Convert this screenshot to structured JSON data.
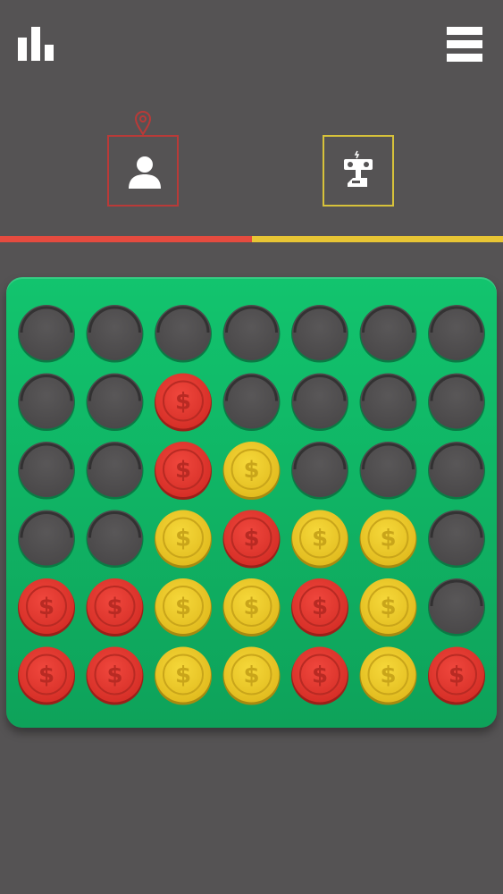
{
  "header": {
    "stats_icon": "bar-chart-icon",
    "menu_icon": "hamburger-menu-icon"
  },
  "players": [
    {
      "id": "human",
      "icon": "user-icon",
      "color": "#b93a38",
      "active": true
    },
    {
      "id": "robot",
      "icon": "robot-icon",
      "color": "#d7c23a",
      "active": false
    }
  ],
  "turn_indicator": {
    "icon": "location-pin-icon",
    "player": "human"
  },
  "score_bar": {
    "red_fraction": 0.5,
    "red_color": "#e54b3f",
    "yellow_color": "#e8c534"
  },
  "board": {
    "columns": 7,
    "rows": 6,
    "coin_symbol": "$",
    "colors": {
      "R": "#e53b32",
      "Y": "#ecc92b",
      "empty": "#4e4c4d"
    },
    "cells": [
      [
        "",
        "",
        "",
        "",
        "",
        "",
        ""
      ],
      [
        "",
        "",
        "R",
        "",
        "",
        "",
        ""
      ],
      [
        "",
        "",
        "R",
        "Y",
        "",
        "",
        ""
      ],
      [
        "",
        "",
        "Y",
        "R",
        "Y",
        "Y",
        ""
      ],
      [
        "R",
        "R",
        "Y",
        "Y",
        "R",
        "Y",
        ""
      ],
      [
        "R",
        "R",
        "Y",
        "Y",
        "R",
        "Y",
        "R"
      ]
    ]
  }
}
